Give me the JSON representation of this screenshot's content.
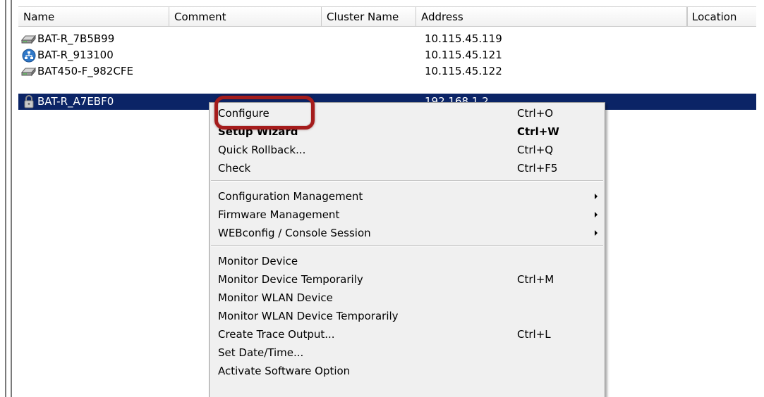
{
  "table": {
    "columns": [
      {
        "label": "Name"
      },
      {
        "label": "Comment"
      },
      {
        "label": "Cluster Name"
      },
      {
        "label": "Address"
      },
      {
        "label": ""
      },
      {
        "label": "Location"
      }
    ],
    "rows": [
      {
        "name": "BAT-R_7B5B99",
        "address": "10.115.45.119",
        "icon": "router-device-icon",
        "selected": false
      },
      {
        "name": "BAT-R_913100",
        "address": "10.115.45.121",
        "icon": "network-device-icon",
        "selected": false
      },
      {
        "name": "BAT450-F_982CFE",
        "address": "10.115.45.122",
        "icon": "router-device-icon",
        "selected": false
      },
      {
        "name": "BAT-R_A7EBF0",
        "address": "192.168.1.2",
        "icon": "lock-icon",
        "selected": true
      }
    ]
  },
  "context_menu": {
    "groups": [
      [
        {
          "label": "Configure",
          "shortcut": "Ctrl+O"
        },
        {
          "label": "Setup Wizard",
          "shortcut": "Ctrl+W",
          "bold": true
        },
        {
          "label": "Quick Rollback...",
          "shortcut": "Ctrl+Q"
        },
        {
          "label": "Check",
          "shortcut": "Ctrl+F5"
        }
      ],
      [
        {
          "label": "Configuration Management",
          "submenu": true
        },
        {
          "label": "Firmware Management",
          "submenu": true
        },
        {
          "label": "WEBconfig / Console Session",
          "submenu": true
        }
      ],
      [
        {
          "label": "Monitor Device"
        },
        {
          "label": "Monitor Device Temporarily",
          "shortcut": "Ctrl+M"
        },
        {
          "label": "Monitor WLAN Device"
        },
        {
          "label": "Monitor WLAN Device Temporarily"
        },
        {
          "label": "Create Trace Output...",
          "shortcut": "Ctrl+L"
        },
        {
          "label": "Set Date/Time..."
        },
        {
          "label": "Activate Software Option"
        }
      ]
    ]
  },
  "highlight": {
    "target": "Configure",
    "color": "#a51c1c"
  },
  "colors": {
    "selection": "#0b2466",
    "menu_bg": "#f0f0f0"
  }
}
